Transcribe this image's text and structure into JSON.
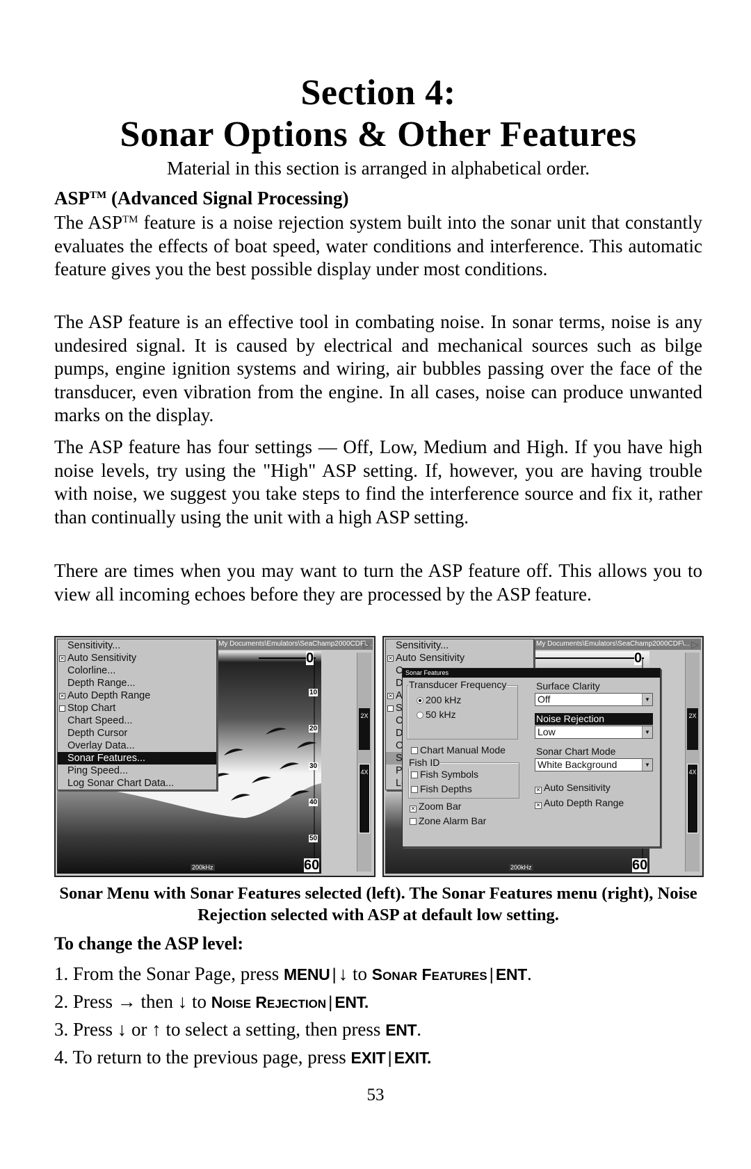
{
  "header": {
    "section_label": "Section 4:",
    "section_title": "Sonar Options & Other Features",
    "subtitle": "Material in this section is arranged in alphabetical order."
  },
  "asp": {
    "heading_prefix": "ASP",
    "heading_tm": "TM",
    "heading_suffix": " (Advanced Signal Processing)",
    "p1_prefix": "The ASP",
    "p1_tm": "TM",
    "p1_suffix": " feature is a noise rejection system built into the sonar unit that constantly evaluates the effects of boat speed, water conditions and interference. This automatic feature gives you the best possible display under most conditions.",
    "p2": "The ASP feature is an effective tool in combating noise. In sonar terms, noise is any undesired signal. It is caused by electrical and mechanical sources such as bilge pumps, engine ignition systems and wiring, air bubbles passing over the face of the transducer, even vibration from the engine. In all cases, noise can produce unwanted marks on the display.",
    "p3": "The ASP feature has four settings — Off, Low, Medium and High. If you have high noise levels, try using the \"High\" ASP setting. If, however, you are having trouble with noise, we suggest you take steps to find the interference source and fix it, rather than continually using the unit with a high ASP setting.",
    "p4": "There are times when you may want to turn the ASP feature off. This allows you to view all incoming echoes before they are processed by the ASP feature."
  },
  "screens": {
    "path_text": "My Documents\\Emulators\\SeaChamp2000CDF\\...",
    "path_arrow_icon": "play-triangle-icon",
    "zoom_2x": "2X",
    "zoom_4x": "4X",
    "depth_top": "0",
    "depth_bottom": "60",
    "depth_ticks": [
      "10",
      "20",
      "30",
      "40",
      "50"
    ],
    "frequency_label": "200kHz",
    "left": {
      "menu_items": [
        {
          "label": "Sensitivity...",
          "checkbox": null,
          "selected": false
        },
        {
          "label": "Auto Sensitivity",
          "checkbox": true,
          "selected": false
        },
        {
          "label": "Colorline...",
          "checkbox": null,
          "selected": false
        },
        {
          "label": "Depth Range...",
          "checkbox": null,
          "selected": false
        },
        {
          "label": "Auto Depth Range",
          "checkbox": true,
          "selected": false
        },
        {
          "label": "Stop Chart",
          "checkbox": false,
          "selected": false
        },
        {
          "label": "Chart Speed...",
          "checkbox": null,
          "selected": false
        },
        {
          "label": "Depth Cursor",
          "checkbox": null,
          "selected": false
        },
        {
          "label": "Overlay Data...",
          "checkbox": null,
          "selected": false
        },
        {
          "label": "Sonar Features...",
          "checkbox": null,
          "selected": true
        },
        {
          "label": "Ping Speed...",
          "checkbox": null,
          "selected": false
        },
        {
          "label": "Log Sonar Chart Data...",
          "checkbox": null,
          "selected": false
        }
      ]
    },
    "right": {
      "background_menu_items": [
        "Sensitivity...",
        "Auto Sensitivity",
        "C",
        "D",
        "A",
        "S",
        "C",
        "D",
        "O",
        "S",
        "Pi",
        "Lo"
      ],
      "dialog": {
        "title": "Sonar Features",
        "transducer_frequency": {
          "label": "Transducer Frequency",
          "options": [
            {
              "label": "200 kHz",
              "selected": true
            },
            {
              "label": "50 kHz",
              "selected": false
            }
          ]
        },
        "chart_manual_mode": {
          "label": "Chart Manual Mode",
          "checked": false
        },
        "fish_id": {
          "label": "Fish ID",
          "fish_symbols": {
            "label": "Fish Symbols",
            "checked": false
          },
          "fish_depths": {
            "label": "Fish Depths",
            "checked": false
          }
        },
        "zoom_bar": {
          "label": "Zoom Bar",
          "checked": true
        },
        "zone_alarm_bar": {
          "label": "Zone Alarm Bar",
          "checked": false
        },
        "surface_clarity": {
          "label": "Surface Clarity",
          "value": "Off"
        },
        "noise_rejection": {
          "label": "Noise Rejection",
          "value": "Low",
          "selected": true
        },
        "sonar_chart_mode": {
          "label": "Sonar Chart Mode",
          "value": "White Background"
        },
        "auto_sensitivity": {
          "label": "Auto Sensitivity",
          "checked": true
        },
        "auto_depth_range": {
          "label": "Auto Depth Range",
          "checked": true
        }
      }
    }
  },
  "caption": "Sonar Menu with Sonar Features selected (left). The Sonar Features menu (right), Noise Rejection selected with ASP at default low setting.",
  "procedure": {
    "heading": "To change the ASP level:",
    "steps": [
      {
        "num": "1.",
        "text_a": "From the Sonar Page, press ",
        "key1": "MENU",
        "sep1": "|",
        "arrow": "↓",
        "text_b": " to ",
        "sc1_first": "S",
        "sc1_rest": "ONAR",
        "sc2_first": "F",
        "sc2_rest": "EATURES",
        "sep2": "|",
        "key2": "ENT",
        "end": "."
      },
      {
        "num": "2.",
        "text_a": "Press ",
        "arrow1": "→",
        "text_b": " then ",
        "arrow2": "↓",
        "text_c": " to ",
        "sc1_first": "N",
        "sc1_rest": "OISE",
        "sc2_first": "R",
        "sc2_rest": "EJECTION",
        "sep": "|",
        "key": "ENT."
      },
      {
        "num": "3.",
        "text_a": "Press ",
        "arrow1": "↓",
        "text_b": " or ",
        "arrow2": "↑",
        "text_c": " to select a setting, then press ",
        "key": "ENT",
        "end": "."
      },
      {
        "num": "4.",
        "text_a": "To return to the previous page, press ",
        "key1": "EXIT",
        "sep": "|",
        "key2": "EXIT."
      }
    ]
  },
  "page_number": "53"
}
